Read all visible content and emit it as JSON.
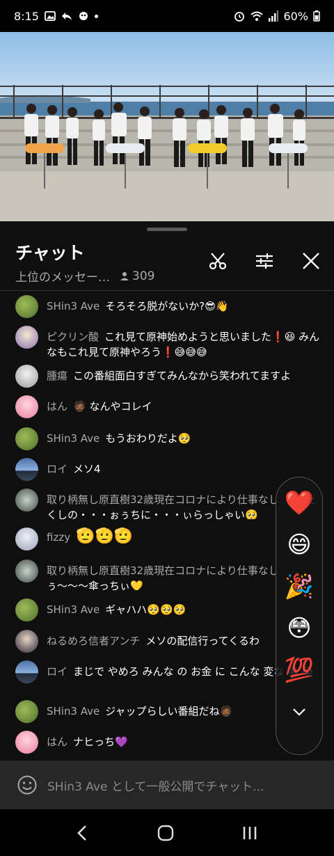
{
  "status": {
    "time": "8:15",
    "battery": "60%"
  },
  "chat": {
    "title": "チャット",
    "mode": "上位のメッセー…",
    "viewers": "309"
  },
  "messages": [
    {
      "author": "SHin3 Ave",
      "text": "そろそろ脱がないか?😎👋"
    },
    {
      "author": "ピクリン酸",
      "text": "これ見て原神始めようと思いました❗😆 みんなもこれ見て原神やろう❗😅😅😅"
    },
    {
      "author": "腫瘍",
      "text": "この番組面白すぎてみんなから笑われてますよ"
    },
    {
      "author": "はん",
      "text": "🧔🏾 なんやコレイ"
    },
    {
      "author": "SHin3 Ave",
      "text": "もうおわりだよ🥺"
    },
    {
      "author": "ロイ",
      "text": "メソ4"
    },
    {
      "author": "取り柄無し原直樹32歳現在コロナにより仕事なし",
      "text": "ぅぁたくしの・・・ぉぅちに・・・ぃらっしゃい🥺"
    },
    {
      "author": "fizzy",
      "text": "🫡🫡🫡"
    },
    {
      "author": "取り柄無し原直樹32歳現在コロナにより仕事なし",
      "text": "ぅ〜〜〜傘っちぃ💛"
    },
    {
      "author": "SHin3 Ave",
      "text": "ギャハハ🥺🥺🥺"
    },
    {
      "author": "ねるめろ信者アンチ",
      "text": "メソの配信行ってくるわ"
    },
    {
      "author": "ロイ",
      "text": "まじで やめろ みんな の お金 に こんな 変な 事 😭"
    },
    {
      "author": "SHin3 Ave",
      "text": "ジャップらしい番組だね🧔🏾"
    },
    {
      "author": "はん",
      "text": "ナヒっち💜"
    }
  ],
  "reactions": [
    "❤️",
    "😄",
    "🎉",
    "😳",
    "💯"
  ],
  "input": {
    "placeholder": "SHin3 Ave として一般公開でチャット..."
  },
  "colors": {
    "background": "#0f0f0f",
    "input_bg": "#272727",
    "author": "#aaaaaa"
  }
}
